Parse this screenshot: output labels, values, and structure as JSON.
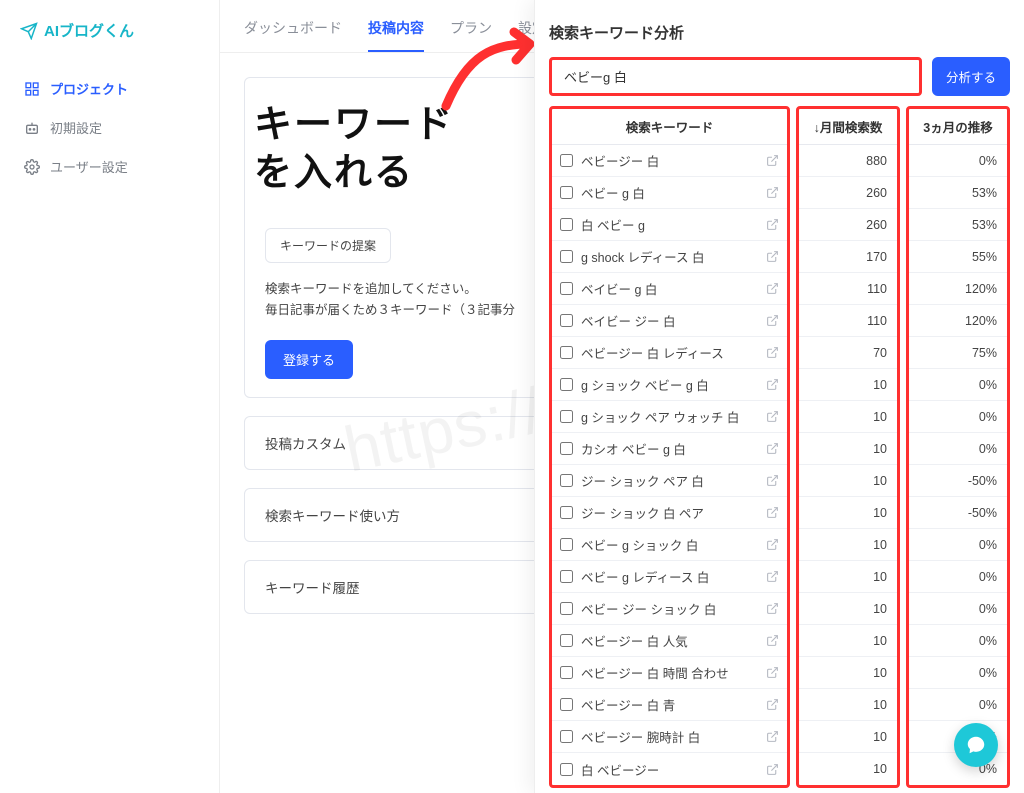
{
  "brand": "AIブログくん",
  "sidebar": {
    "items": [
      {
        "label": "プロジェクト",
        "icon": "squares"
      },
      {
        "label": "初期設定",
        "icon": "robot"
      },
      {
        "label": "ユーザー設定",
        "icon": "gear"
      }
    ]
  },
  "tabs": [
    "ダッシュボード",
    "投稿内容",
    "プラン",
    "設定"
  ],
  "annotation": {
    "line1": "キーワード",
    "line2": "を入れる"
  },
  "watermark": "https://coletto.link",
  "card": {
    "suggest_btn": "キーワードの提案",
    "hint1": "検索キーワードを追加してください。",
    "hint2": "毎日記事が届くため３キーワード（３記事分",
    "register_btn": "登録する"
  },
  "simple_cards": [
    "投稿カスタム",
    "検索キーワード使い方",
    "キーワード履歴"
  ],
  "panel": {
    "title": "検索キーワード分析",
    "search_value": "ベビーg 白",
    "analyze_btn": "分析する",
    "headers": {
      "kw": "検索キーワード",
      "vol": "↓月間検索数",
      "trend": "3ヵ月の推移"
    },
    "rows": [
      {
        "kw": "ベビージー 白",
        "vol": "880",
        "trend": "0%"
      },
      {
        "kw": "ベビー g 白",
        "vol": "260",
        "trend": "53%"
      },
      {
        "kw": "白 ベビー g",
        "vol": "260",
        "trend": "53%"
      },
      {
        "kw": "g shock レディース 白",
        "vol": "170",
        "trend": "55%"
      },
      {
        "kw": "ベイビー g 白",
        "vol": "110",
        "trend": "120%"
      },
      {
        "kw": "ベイビー ジー 白",
        "vol": "110",
        "trend": "120%"
      },
      {
        "kw": "ベビージー 白 レディース",
        "vol": "70",
        "trend": "75%"
      },
      {
        "kw": "g ショック ベビー g 白",
        "vol": "10",
        "trend": "0%"
      },
      {
        "kw": "g ショック ペア ウォッチ 白",
        "vol": "10",
        "trend": "0%"
      },
      {
        "kw": "カシオ ベビー g 白",
        "vol": "10",
        "trend": "0%"
      },
      {
        "kw": "ジー ショック ペア 白",
        "vol": "10",
        "trend": "-50%"
      },
      {
        "kw": "ジー ショック 白 ペア",
        "vol": "10",
        "trend": "-50%"
      },
      {
        "kw": "ベビー g ショック 白",
        "vol": "10",
        "trend": "0%"
      },
      {
        "kw": "ベビー g レディース 白",
        "vol": "10",
        "trend": "0%"
      },
      {
        "kw": "ベビー ジー ショック 白",
        "vol": "10",
        "trend": "0%"
      },
      {
        "kw": "ベビージー 白 人気",
        "vol": "10",
        "trend": "0%"
      },
      {
        "kw": "ベビージー 白 時間 合わせ",
        "vol": "10",
        "trend": "0%"
      },
      {
        "kw": "ベビージー 白 青",
        "vol": "10",
        "trend": "0%"
      },
      {
        "kw": "ベビージー 腕時計 白",
        "vol": "10",
        "trend": "0%"
      },
      {
        "kw": "白 ベビージー",
        "vol": "10",
        "trend": "0%"
      }
    ]
  }
}
